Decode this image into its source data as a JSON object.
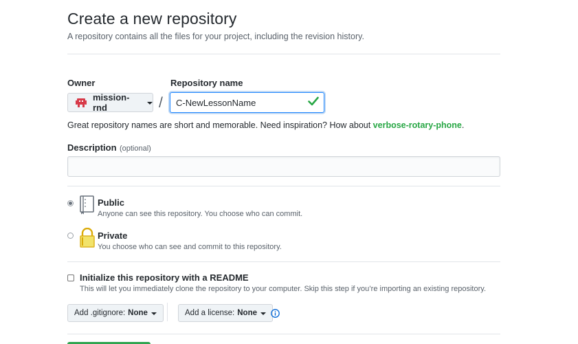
{
  "header": {
    "title": "Create a new repository",
    "subtitle": "A repository contains all the files for your project, including the revision history."
  },
  "owner": {
    "label": "Owner",
    "selected": "mission-rnd"
  },
  "separator_text": "/",
  "repo_name": {
    "label": "Repository name",
    "value": "C-NewLessonName"
  },
  "hint": {
    "text": "Great repository names are short and memorable. Need inspiration? How about ",
    "suggestion": "verbose-rotary-phone",
    "end": "."
  },
  "description": {
    "label": "Description",
    "optional": "(optional)",
    "value": ""
  },
  "visibility": {
    "public": {
      "title": "Public",
      "note": "Anyone can see this repository. You choose who can commit.",
      "checked": true
    },
    "private": {
      "title": "Private",
      "note": "You choose who can see and commit to this repository.",
      "checked": false
    }
  },
  "readme": {
    "title": "Initialize this repository with a README",
    "note": "This will let you immediately clone the repository to your computer. Skip this step if you’re importing an existing repository.",
    "checked": false
  },
  "gitignore": {
    "label": "Add .gitignore:",
    "value": "None"
  },
  "license": {
    "label": "Add a license:",
    "value": "None"
  },
  "colors": {
    "accent_blue": "#2188ff",
    "success_green": "#28a745",
    "owner_avatar": "#d73a49"
  },
  "icons": {
    "owner": "organization-avatar-icon",
    "valid": "checkmark-icon",
    "public": "repo-book-icon",
    "private": "lock-icon",
    "info": "info-icon"
  }
}
